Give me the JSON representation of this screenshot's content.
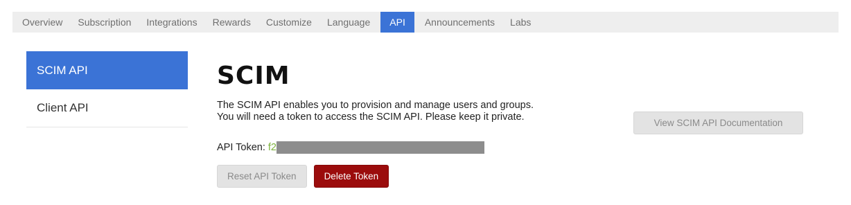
{
  "tabs": [
    {
      "label": "Overview",
      "active": false
    },
    {
      "label": "Subscription",
      "active": false
    },
    {
      "label": "Integrations",
      "active": false
    },
    {
      "label": "Rewards",
      "active": false
    },
    {
      "label": "Customize",
      "active": false
    },
    {
      "label": "Language",
      "active": false
    },
    {
      "label": "API",
      "active": true
    },
    {
      "label": "Announcements",
      "active": false
    },
    {
      "label": "Labs",
      "active": false
    }
  ],
  "sidebar": {
    "items": [
      {
        "label": "SCIM API",
        "active": true
      },
      {
        "label": "Client API",
        "active": false
      }
    ]
  },
  "main": {
    "heading": "SCIM",
    "description_line1": "The SCIM API enables you to provision and manage users and groups.",
    "description_line2": "You will need a token to access the SCIM API. Please keep it private.",
    "token_label": "API Token:",
    "token_prefix": "f2",
    "reset_button": "Reset API Token",
    "delete_button": "Delete Token",
    "docs_button": "View SCIM API Documentation"
  },
  "colors": {
    "accent": "#3b73d6",
    "danger": "#9b0c0c",
    "token_text": "#7bb13a",
    "tabbar_bg": "#eeeeee"
  }
}
